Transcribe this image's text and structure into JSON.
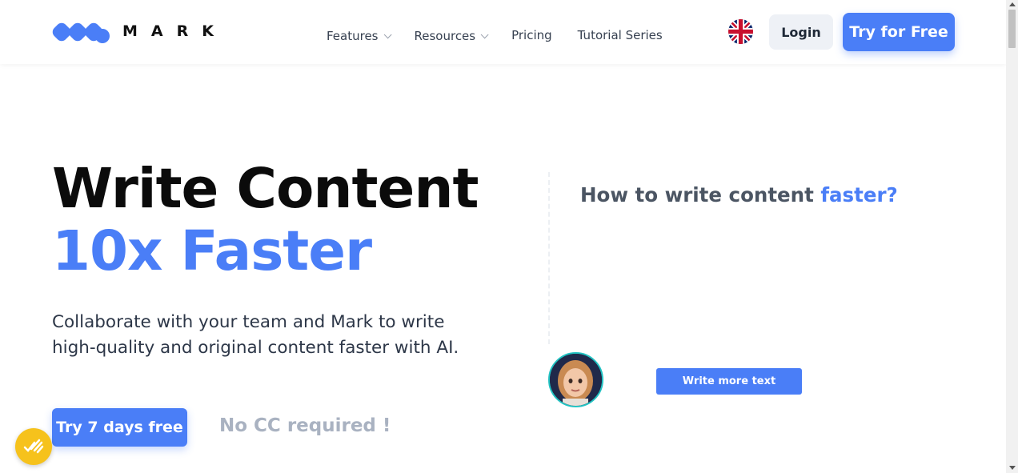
{
  "brand": {
    "name": "MARK",
    "logo_icon": "mark-logo-icon",
    "accent_color": "#4a7ef7"
  },
  "nav": {
    "items": [
      {
        "label": "Features",
        "has_dropdown": true
      },
      {
        "label": "Resources",
        "has_dropdown": true
      },
      {
        "label": "Pricing",
        "has_dropdown": false
      },
      {
        "label": "Tutorial Series",
        "has_dropdown": false
      }
    ],
    "language_icon": "uk-flag-icon",
    "login_label": "Login",
    "try_label": "Try for Free"
  },
  "hero": {
    "title_line1": "Write Content",
    "title_line2": "10x Faster",
    "subtitle": "Collaborate with your team and Mark to write high-quality and original content faster with AI.",
    "cta_label": "Try 7 days free",
    "cta_note": "No CC required !"
  },
  "demo": {
    "question_prefix": "How to write content",
    "question_accent": "faster?",
    "avatar_icon": "user-avatar",
    "button_label": "Write more text"
  },
  "widget": {
    "icon": "checklist-badge-icon"
  }
}
